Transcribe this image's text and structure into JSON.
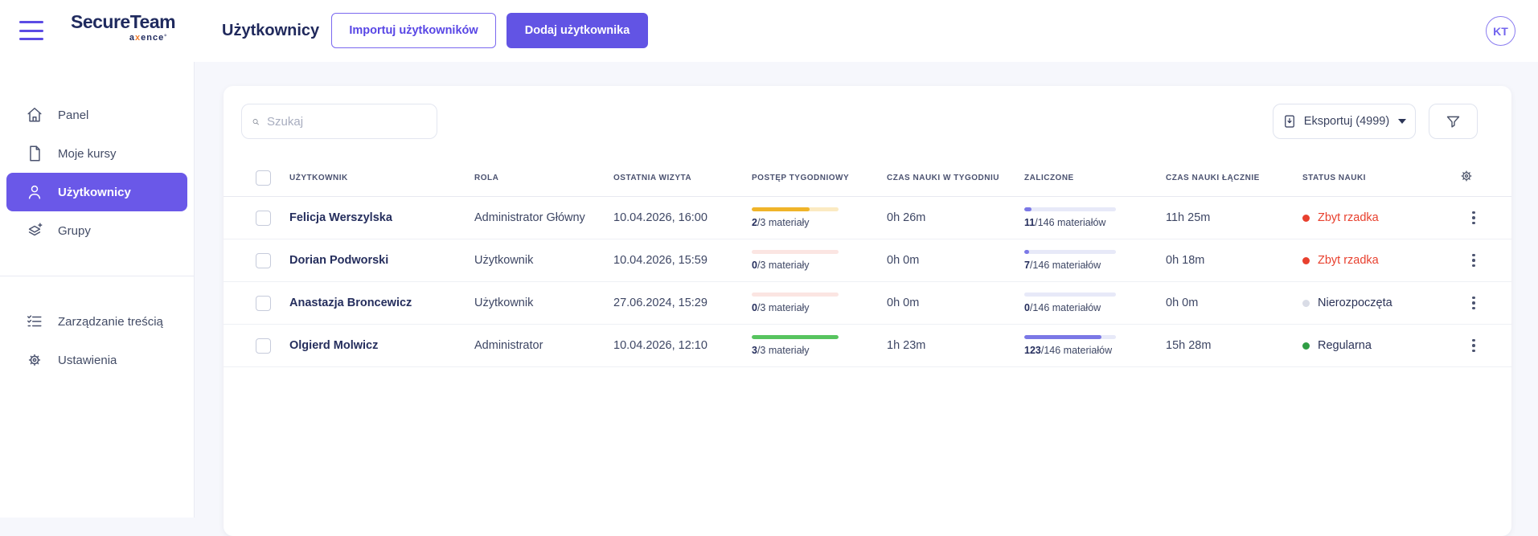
{
  "topbar": {
    "page_title": "Użytkownicy",
    "import_button": "Importuj użytkowników",
    "add_button": "Dodaj użytkownika",
    "avatar_initials": "KT",
    "logo": {
      "title": "SecureTeam",
      "sub_pre": "a",
      "sub_x": "x",
      "sub_post": "ence",
      "sub_mark": "°"
    }
  },
  "sidebar": {
    "items": [
      {
        "label": "Panel"
      },
      {
        "label": "Moje kursy"
      },
      {
        "label": "Użytkownicy"
      },
      {
        "label": "Grupy"
      }
    ],
    "bottom_items": [
      {
        "label": "Zarządzanie treścią"
      },
      {
        "label": "Ustawienia"
      }
    ]
  },
  "toolbar": {
    "search_placeholder": "Szukaj",
    "export_label": "Eksportuj (4999)"
  },
  "colors": {
    "primary_purple": "#6254e4",
    "status_red": "#e8402e",
    "status_green": "#2f9e44"
  },
  "table": {
    "columns": [
      "UŻYTKOWNIK",
      "ROLA",
      "OSTATNIA WIZYTA",
      "POSTĘP TYGODNIOWY",
      "CZAS NAUKI W TYGODNIU",
      "ZALICZONE",
      "CZAS NAUKI ŁĄCZNIE",
      "STATUS NAUKI"
    ],
    "rows": [
      {
        "name": "Felicja Werszylska",
        "role": "Administrator Główny",
        "last_visit": "10.04.2026, 16:00",
        "weekly_done": "2",
        "weekly_rest": "/3 materiały",
        "weekly_pct": 66.7,
        "weekly_fill": "#f0b429",
        "weekly_track": "#fbeac2",
        "week_time": "0h 26m",
        "done_count": "11",
        "done_rest": "/146 materiałów",
        "done_pct": 8,
        "done_fill": "#7b78e6",
        "done_track": "#e7e9f8",
        "total_time": "11h 25m",
        "status_label": "Zbyt rzadka",
        "status_dot": "#e8402e",
        "status_text": "#e8402e"
      },
      {
        "name": "Dorian Podworski",
        "role": "Użytkownik",
        "last_visit": "10.04.2026, 15:59",
        "weekly_done": "0",
        "weekly_rest": "/3 materiały",
        "weekly_pct": 0,
        "weekly_fill": "#f0b429",
        "weekly_track": "#fbe5e2",
        "week_time": "0h 0m",
        "done_count": "7",
        "done_rest": "/146 materiałów",
        "done_pct": 5,
        "done_fill": "#7b78e6",
        "done_track": "#e7e9f8",
        "total_time": "0h 18m",
        "status_label": "Zbyt rzadka",
        "status_dot": "#e8402e",
        "status_text": "#e8402e"
      },
      {
        "name": "Anastazja Broncewicz",
        "role": "Użytkownik",
        "last_visit": "27.06.2024, 15:29",
        "weekly_done": "0",
        "weekly_rest": "/3 materiały",
        "weekly_pct": 0,
        "weekly_fill": "#f0b429",
        "weekly_track": "#fbe5e2",
        "week_time": "0h 0m",
        "done_count": "0",
        "done_rest": "/146 materiałów",
        "done_pct": 0,
        "done_fill": "#7b78e6",
        "done_track": "#e7e9f8",
        "total_time": "0h 0m",
        "status_label": "Nierozpoczęta",
        "status_dot": "#d9dce6",
        "status_text": "#2b3357"
      },
      {
        "name": "Olgierd Molwicz",
        "role": "Administrator",
        "last_visit": "10.04.2026, 12:10",
        "weekly_done": "3",
        "weekly_rest": "/3 materiały",
        "weekly_pct": 100,
        "weekly_fill": "#57c45f",
        "weekly_track": "#e3f5e4",
        "week_time": "1h 23m",
        "done_count": "123",
        "done_rest": "/146 materiałów",
        "done_pct": 84.2,
        "done_fill": "#7b78e6",
        "done_track": "#e7e9f8",
        "total_time": "15h 28m",
        "status_label": "Regularna",
        "status_dot": "#2f9e44",
        "status_text": "#2b3357"
      }
    ]
  }
}
